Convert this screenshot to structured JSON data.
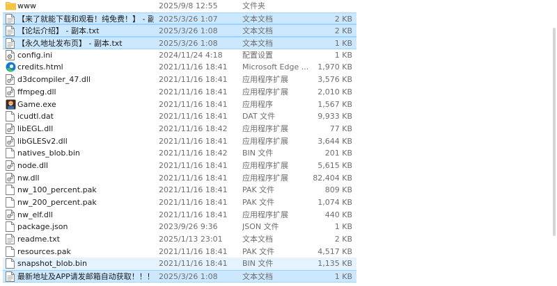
{
  "files": [
    {
      "name": "www",
      "date": "2025/9/8 12:55",
      "type": "文件夹",
      "size": "",
      "icon": "folder-icon",
      "state": "normal"
    },
    {
      "name": "【来了就能下载和观看！纯免费！】 - 副...",
      "date": "2025/3/26 1:07",
      "type": "文本文档",
      "size": "2 KB",
      "icon": "text-file-icon",
      "state": "selected"
    },
    {
      "name": "【论坛介绍】 - 副本.txt",
      "date": "2025/3/26 1:08",
      "type": "文本文档",
      "size": "2 KB",
      "icon": "text-file-icon",
      "state": "selected"
    },
    {
      "name": "【永久地址发布页】 - 副本.txt",
      "date": "2025/3/26 1:08",
      "type": "文本文档",
      "size": "1 KB",
      "icon": "text-file-icon",
      "state": "selected"
    },
    {
      "name": "config.ini",
      "date": "2024/11/24 4:18",
      "type": "配置设置",
      "size": "1 KB",
      "icon": "config-file-icon",
      "state": "normal"
    },
    {
      "name": "credits.html",
      "date": "2021/11/16 18:41",
      "type": "Microsoft Edge ...",
      "size": "1,970 KB",
      "icon": "edge-icon",
      "state": "normal"
    },
    {
      "name": "d3dcompiler_47.dll",
      "date": "2021/11/16 18:41",
      "type": "应用程序扩展",
      "size": "3,576 KB",
      "icon": "dll-file-icon",
      "state": "normal"
    },
    {
      "name": "ffmpeg.dll",
      "date": "2021/11/16 18:41",
      "type": "应用程序扩展",
      "size": "2,010 KB",
      "icon": "dll-file-icon",
      "state": "normal"
    },
    {
      "name": "Game.exe",
      "date": "2021/11/16 18:41",
      "type": "应用程序",
      "size": "1,567 KB",
      "icon": "game-exe-icon",
      "state": "normal"
    },
    {
      "name": "icudtl.dat",
      "date": "2021/11/16 18:41",
      "type": "DAT 文件",
      "size": "9,933 KB",
      "icon": "blank-file-icon",
      "state": "normal"
    },
    {
      "name": "libEGL.dll",
      "date": "2021/11/16 18:42",
      "type": "应用程序扩展",
      "size": "77 KB",
      "icon": "dll-file-icon",
      "state": "normal"
    },
    {
      "name": "libGLESv2.dll",
      "date": "2021/11/16 18:41",
      "type": "应用程序扩展",
      "size": "3,644 KB",
      "icon": "dll-file-icon",
      "state": "normal"
    },
    {
      "name": "natives_blob.bin",
      "date": "2021/11/16 18:42",
      "type": "BIN 文件",
      "size": "201 KB",
      "icon": "blank-file-icon",
      "state": "normal"
    },
    {
      "name": "node.dll",
      "date": "2021/11/16 18:41",
      "type": "应用程序扩展",
      "size": "5,615 KB",
      "icon": "dll-file-icon",
      "state": "normal"
    },
    {
      "name": "nw.dll",
      "date": "2021/11/16 18:41",
      "type": "应用程序扩展",
      "size": "82,404 KB",
      "icon": "dll-file-icon",
      "state": "normal"
    },
    {
      "name": "nw_100_percent.pak",
      "date": "2021/11/16 18:41",
      "type": "PAK 文件",
      "size": "809 KB",
      "icon": "blank-file-icon",
      "state": "normal"
    },
    {
      "name": "nw_200_percent.pak",
      "date": "2021/11/16 18:41",
      "type": "PAK 文件",
      "size": "1,074 KB",
      "icon": "blank-file-icon",
      "state": "normal"
    },
    {
      "name": "nw_elf.dll",
      "date": "2021/11/16 18:41",
      "type": "应用程序扩展",
      "size": "440 KB",
      "icon": "dll-file-icon",
      "state": "normal"
    },
    {
      "name": "package.json",
      "date": "2023/9/26 9:36",
      "type": "JSON 文件",
      "size": "1 KB",
      "icon": "blank-file-icon",
      "state": "normal"
    },
    {
      "name": "readme.txt",
      "date": "2025/1/13 23:01",
      "type": "文本文档",
      "size": "2 KB",
      "icon": "text-file-icon",
      "state": "normal"
    },
    {
      "name": "resources.pak",
      "date": "2021/11/16 18:41",
      "type": "PAK 文件",
      "size": "4,517 KB",
      "icon": "blank-file-icon",
      "state": "normal"
    },
    {
      "name": "snapshot_blob.bin",
      "date": "2021/11/16 18:41",
      "type": "BIN 文件",
      "size": "1,135 KB",
      "icon": "blank-file-icon",
      "state": "hover"
    },
    {
      "name": "最新地址及APP请发邮箱自动获取！！！...",
      "date": "2025/3/26 1:08",
      "type": "文本文档",
      "size": "1 KB",
      "icon": "text-file-icon",
      "state": "selected"
    }
  ],
  "colors": {
    "selected_bg": "#cce8ff",
    "selected_border": "#99d1ff",
    "hover_bg": "#e5f3ff",
    "folder": "#f5c542",
    "edge_blue": "#0f7bd6",
    "edge_green": "#4ac25e"
  }
}
